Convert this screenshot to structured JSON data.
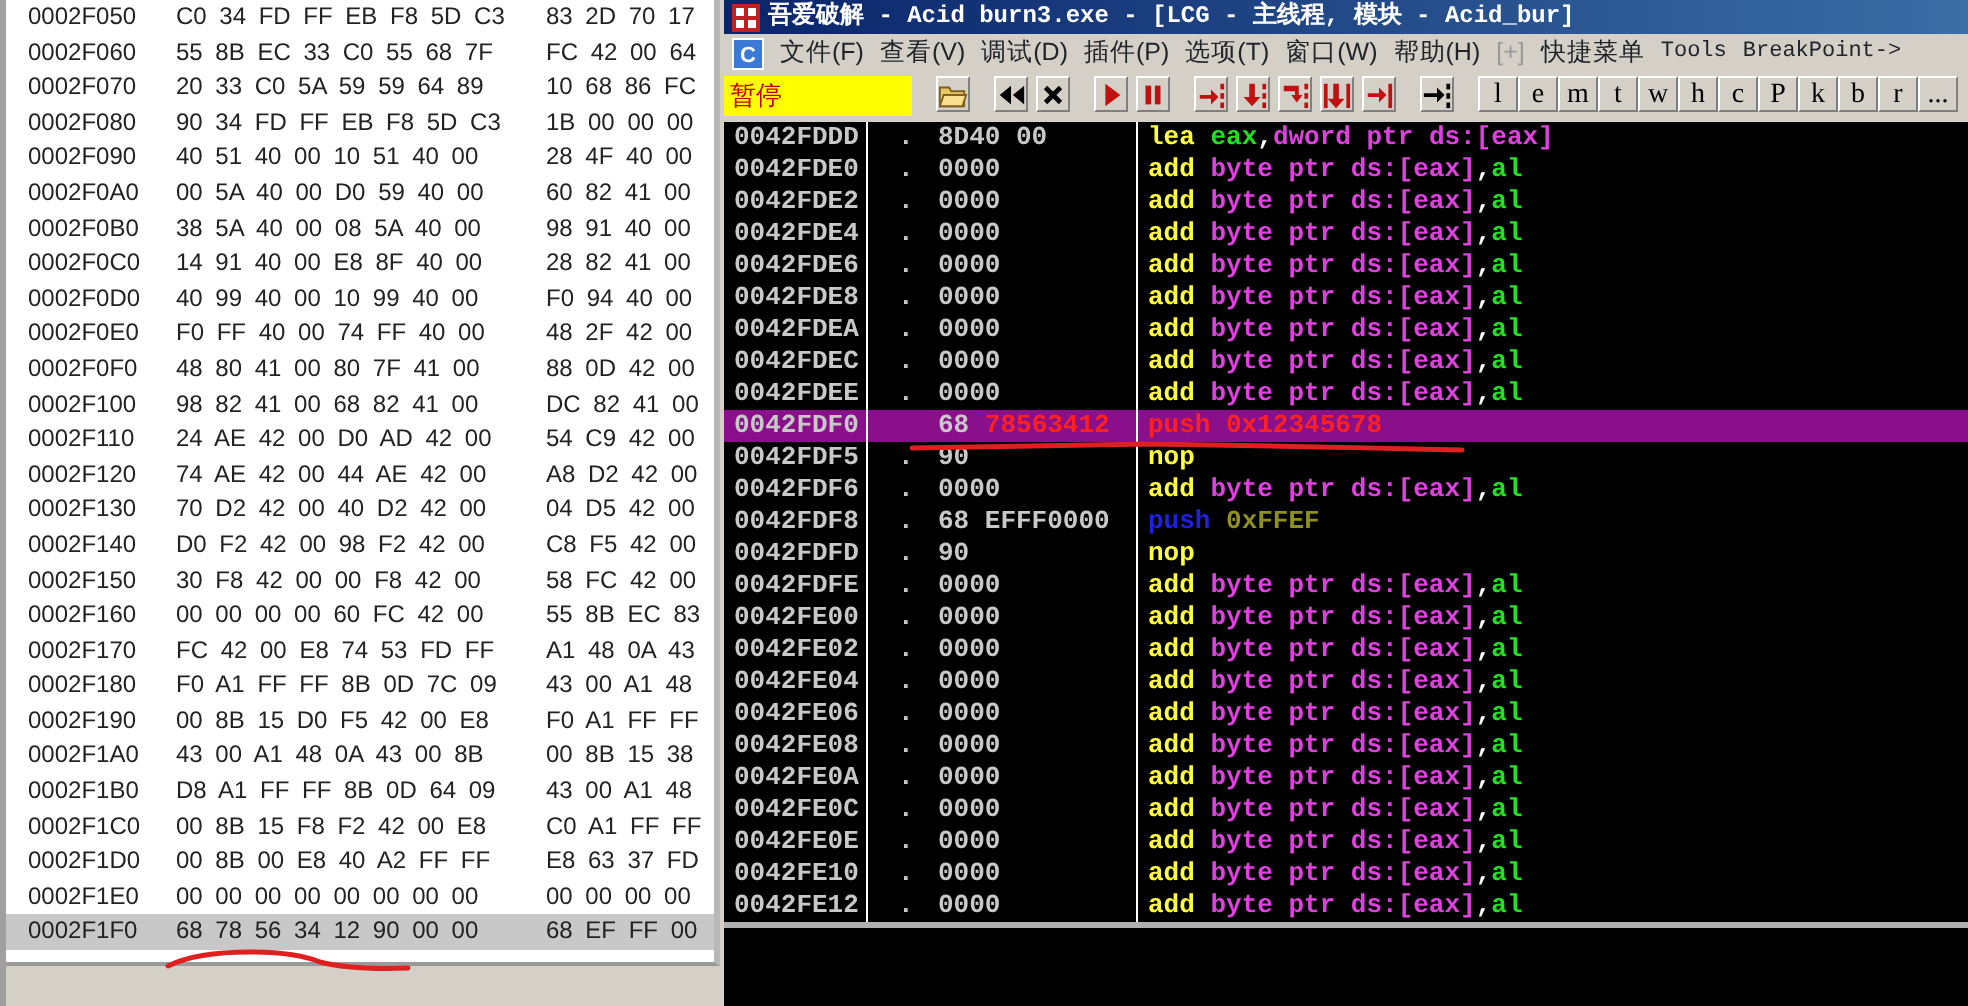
{
  "hex_dump": {
    "rows": [
      {
        "address": "0002F050",
        "group_1": "C0 34 FD FF EB F8 5D C3",
        "group_2": "83 2D 70 17",
        "selected": false
      },
      {
        "address": "0002F060",
        "group_1": "55 8B EC 33 C0 55 68 7F",
        "group_2": "FC 42 00 64",
        "selected": false
      },
      {
        "address": "0002F070",
        "group_1": "20 33 C0 5A 59 59 64 89",
        "group_2": "10 68 86 FC",
        "selected": false
      },
      {
        "address": "0002F080",
        "group_1": "90 34 FD FF EB F8 5D C3",
        "group_2": "1B 00 00 00",
        "selected": false
      },
      {
        "address": "0002F090",
        "group_1": "40 51 40 00 10 51 40 00",
        "group_2": "28 4F 40 00",
        "selected": false
      },
      {
        "address": "0002F0A0",
        "group_1": "00 5A 40 00 D0 59 40 00",
        "group_2": "60 82 41 00",
        "selected": false
      },
      {
        "address": "0002F0B0",
        "group_1": "38 5A 40 00 08 5A 40 00",
        "group_2": "98 91 40 00",
        "selected": false
      },
      {
        "address": "0002F0C0",
        "group_1": "14 91 40 00 E8 8F 40 00",
        "group_2": "28 82 41 00",
        "selected": false
      },
      {
        "address": "0002F0D0",
        "group_1": "40 99 40 00 10 99 40 00",
        "group_2": "F0 94 40 00",
        "selected": false
      },
      {
        "address": "0002F0E0",
        "group_1": "F0 FF 40 00 74 FF 40 00",
        "group_2": "48 2F 42 00",
        "selected": false
      },
      {
        "address": "0002F0F0",
        "group_1": "48 80 41 00 80 7F 41 00",
        "group_2": "88 0D 42 00",
        "selected": false
      },
      {
        "address": "0002F100",
        "group_1": "98 82 41 00 68 82 41 00",
        "group_2": "DC 82 41 00",
        "selected": false
      },
      {
        "address": "0002F110",
        "group_1": "24 AE 42 00 D0 AD 42 00",
        "group_2": "54 C9 42 00",
        "selected": false
      },
      {
        "address": "0002F120",
        "group_1": "74 AE 42 00 44 AE 42 00",
        "group_2": "A8 D2 42 00",
        "selected": false
      },
      {
        "address": "0002F130",
        "group_1": "70 D2 42 00 40 D2 42 00",
        "group_2": "04 D5 42 00",
        "selected": false
      },
      {
        "address": "0002F140",
        "group_1": "D0 F2 42 00 98 F2 42 00",
        "group_2": "C8 F5 42 00",
        "selected": false
      },
      {
        "address": "0002F150",
        "group_1": "30 F8 42 00 00 F8 42 00",
        "group_2": "58 FC 42 00",
        "selected": false
      },
      {
        "address": "0002F160",
        "group_1": "00 00 00 00 60 FC 42 00",
        "group_2": "55 8B EC 83",
        "selected": false
      },
      {
        "address": "0002F170",
        "group_1": "FC 42 00 E8 74 53 FD FF",
        "group_2": "A1 48 0A 43",
        "selected": false
      },
      {
        "address": "0002F180",
        "group_1": "F0 A1 FF FF 8B 0D 7C 09",
        "group_2": "43 00 A1 48",
        "selected": false
      },
      {
        "address": "0002F190",
        "group_1": "00 8B 15 D0 F5 42 00 E8",
        "group_2": "F0 A1 FF FF",
        "selected": false
      },
      {
        "address": "0002F1A0",
        "group_1": "43 00 A1 48 0A 43 00 8B",
        "group_2": "00 8B 15 38",
        "selected": false
      },
      {
        "address": "0002F1B0",
        "group_1": "D8 A1 FF FF 8B 0D 64 09",
        "group_2": "43 00 A1 48",
        "selected": false
      },
      {
        "address": "0002F1C0",
        "group_1": "00 8B 15 F8 F2 42 00 E8",
        "group_2": "C0 A1 FF FF",
        "selected": false
      },
      {
        "address": "0002F1D0",
        "group_1": "00 8B 00 E8 40 A2 FF FF",
        "group_2": "E8 63 37 FD",
        "selected": false
      },
      {
        "address": "0002F1E0",
        "group_1": "00 00 00 00 00 00 00 00",
        "group_2": "00 00 00 00",
        "selected": false
      },
      {
        "address": "0002F1F0",
        "group_1": "68 78 56 34 12 90 00 00",
        "group_2": "68 EF FF 00",
        "selected": true
      }
    ]
  },
  "window": {
    "title": "吾爱破解 - Acid burn3.exe - [LCG -  主线程, 模块 - Acid_bur]"
  },
  "menu_button": "C",
  "menu": [
    {
      "label": "文件(F)",
      "disabled": false
    },
    {
      "label": "查看(V)",
      "disabled": false
    },
    {
      "label": "调试(D)",
      "disabled": false
    },
    {
      "label": "插件(P)",
      "disabled": false
    },
    {
      "label": "选项(T)",
      "disabled": false
    },
    {
      "label": "窗口(W)",
      "disabled": false
    },
    {
      "label": "帮助(H)",
      "disabled": false
    },
    {
      "label": "[+]",
      "disabled": true
    },
    {
      "label": "快捷菜单",
      "disabled": false
    },
    {
      "label": "Tools",
      "disabled": false
    },
    {
      "label": "BreakPoint->",
      "disabled": false
    }
  ],
  "toolbar": {
    "status": "暂停",
    "icon_buttons": [
      {
        "kind": "open"
      },
      {
        "kind": "rewind"
      },
      {
        "kind": "close"
      },
      {
        "kind": "run"
      },
      {
        "kind": "pause"
      },
      {
        "kind": "step_into"
      },
      {
        "kind": "step_over"
      },
      {
        "kind": "trace_into"
      },
      {
        "kind": "trace_over"
      },
      {
        "kind": "till_return"
      },
      {
        "kind": "goto"
      }
    ],
    "letter_buttons": [
      "l",
      "e",
      "m",
      "t",
      "w",
      "h",
      "c",
      "P",
      "k",
      "b",
      "r",
      "..."
    ]
  },
  "disassembly": {
    "rows": [
      {
        "address": "0042FDDD",
        "marker": ".",
        "bytes": [
          {
            "text": "8D40 00",
            "kind": "plain"
          }
        ],
        "instruction": [
          {
            "text": "lea",
            "kind": "op"
          },
          {
            "text": "eax",
            "kind": "reg"
          },
          {
            "text": ",",
            "kind": "sep"
          },
          {
            "text": "dword ptr ds:[eax]",
            "kind": "mem"
          }
        ],
        "selected": false
      },
      {
        "address": "0042FDE0",
        "marker": ".",
        "bytes": [
          {
            "text": "0000",
            "kind": "plain"
          }
        ],
        "instruction": [
          {
            "text": "add",
            "kind": "op"
          },
          {
            "text": "byte ptr ds:[eax]",
            "kind": "mem"
          },
          {
            "text": ",",
            "kind": "sep"
          },
          {
            "text": "al",
            "kind": "reg"
          }
        ],
        "selected": false
      },
      {
        "address": "0042FDE2",
        "marker": ".",
        "bytes": [
          {
            "text": "0000",
            "kind": "plain"
          }
        ],
        "instruction": [
          {
            "text": "add",
            "kind": "op"
          },
          {
            "text": "byte ptr ds:[eax]",
            "kind": "mem"
          },
          {
            "text": ",",
            "kind": "sep"
          },
          {
            "text": "al",
            "kind": "reg"
          }
        ],
        "selected": false
      },
      {
        "address": "0042FDE4",
        "marker": ".",
        "bytes": [
          {
            "text": "0000",
            "kind": "plain"
          }
        ],
        "instruction": [
          {
            "text": "add",
            "kind": "op"
          },
          {
            "text": "byte ptr ds:[eax]",
            "kind": "mem"
          },
          {
            "text": ",",
            "kind": "sep"
          },
          {
            "text": "al",
            "kind": "reg"
          }
        ],
        "selected": false
      },
      {
        "address": "0042FDE6",
        "marker": ".",
        "bytes": [
          {
            "text": "0000",
            "kind": "plain"
          }
        ],
        "instruction": [
          {
            "text": "add",
            "kind": "op"
          },
          {
            "text": "byte ptr ds:[eax]",
            "kind": "mem"
          },
          {
            "text": ",",
            "kind": "sep"
          },
          {
            "text": "al",
            "kind": "reg"
          }
        ],
        "selected": false
      },
      {
        "address": "0042FDE8",
        "marker": ".",
        "bytes": [
          {
            "text": "0000",
            "kind": "plain"
          }
        ],
        "instruction": [
          {
            "text": "add",
            "kind": "op"
          },
          {
            "text": "byte ptr ds:[eax]",
            "kind": "mem"
          },
          {
            "text": ",",
            "kind": "sep"
          },
          {
            "text": "al",
            "kind": "reg"
          }
        ],
        "selected": false
      },
      {
        "address": "0042FDEA",
        "marker": ".",
        "bytes": [
          {
            "text": "0000",
            "kind": "plain"
          }
        ],
        "instruction": [
          {
            "text": "add",
            "kind": "op"
          },
          {
            "text": "byte ptr ds:[eax]",
            "kind": "mem"
          },
          {
            "text": ",",
            "kind": "sep"
          },
          {
            "text": "al",
            "kind": "reg"
          }
        ],
        "selected": false
      },
      {
        "address": "0042FDEC",
        "marker": ".",
        "bytes": [
          {
            "text": "0000",
            "kind": "plain"
          }
        ],
        "instruction": [
          {
            "text": "add",
            "kind": "op"
          },
          {
            "text": "byte ptr ds:[eax]",
            "kind": "mem"
          },
          {
            "text": ",",
            "kind": "sep"
          },
          {
            "text": "al",
            "kind": "reg"
          }
        ],
        "selected": false
      },
      {
        "address": "0042FDEE",
        "marker": ".",
        "bytes": [
          {
            "text": "0000",
            "kind": "plain"
          }
        ],
        "instruction": [
          {
            "text": "add",
            "kind": "op"
          },
          {
            "text": "byte ptr ds:[eax]",
            "kind": "mem"
          },
          {
            "text": ",",
            "kind": "sep"
          },
          {
            "text": "al",
            "kind": "reg"
          }
        ],
        "selected": false
      },
      {
        "address": "0042FDF0",
        "bytes": [
          {
            "text": "68",
            "kind": "plain"
          },
          {
            "text": "78563412",
            "kind": "changed"
          }
        ],
        "instruction": [
          {
            "text": "push 0x12345678",
            "kind": "changed"
          }
        ],
        "selected": true
      },
      {
        "address": "0042FDF5",
        "marker": ".",
        "bytes": [
          {
            "text": "90",
            "kind": "plain"
          }
        ],
        "instruction": [
          {
            "text": "nop",
            "kind": "op"
          }
        ],
        "selected": false
      },
      {
        "address": "0042FDF6",
        "marker": ".",
        "bytes": [
          {
            "text": "0000",
            "kind": "plain"
          }
        ],
        "instruction": [
          {
            "text": "add",
            "kind": "op"
          },
          {
            "text": "byte ptr ds:[eax]",
            "kind": "mem"
          },
          {
            "text": ",",
            "kind": "sep"
          },
          {
            "text": "al",
            "kind": "reg"
          }
        ],
        "selected": false
      },
      {
        "address": "0042FDF8",
        "marker": ".",
        "bytes": [
          {
            "text": "68 EFFF0000",
            "kind": "plain"
          }
        ],
        "instruction": [
          {
            "text": "push",
            "kind": "stack"
          },
          {
            "text": "0xFFEF",
            "kind": "imm"
          }
        ],
        "selected": false
      },
      {
        "address": "0042FDFD",
        "marker": ".",
        "bytes": [
          {
            "text": "90",
            "kind": "plain"
          }
        ],
        "instruction": [
          {
            "text": "nop",
            "kind": "op"
          }
        ],
        "selected": false
      },
      {
        "address": "0042FDFE",
        "marker": ".",
        "bytes": [
          {
            "text": "0000",
            "kind": "plain"
          }
        ],
        "instruction": [
          {
            "text": "add",
            "kind": "op"
          },
          {
            "text": "byte ptr ds:[eax]",
            "kind": "mem"
          },
          {
            "text": ",",
            "kind": "sep"
          },
          {
            "text": "al",
            "kind": "reg"
          }
        ],
        "selected": false
      },
      {
        "address": "0042FE00",
        "marker": ".",
        "bytes": [
          {
            "text": "0000",
            "kind": "plain"
          }
        ],
        "instruction": [
          {
            "text": "add",
            "kind": "op"
          },
          {
            "text": "byte ptr ds:[eax]",
            "kind": "mem"
          },
          {
            "text": ",",
            "kind": "sep"
          },
          {
            "text": "al",
            "kind": "reg"
          }
        ],
        "selected": false
      },
      {
        "address": "0042FE02",
        "marker": ".",
        "bytes": [
          {
            "text": "0000",
            "kind": "plain"
          }
        ],
        "instruction": [
          {
            "text": "add",
            "kind": "op"
          },
          {
            "text": "byte ptr ds:[eax]",
            "kind": "mem"
          },
          {
            "text": ",",
            "kind": "sep"
          },
          {
            "text": "al",
            "kind": "reg"
          }
        ],
        "selected": false
      },
      {
        "address": "0042FE04",
        "marker": ".",
        "bytes": [
          {
            "text": "0000",
            "kind": "plain"
          }
        ],
        "instruction": [
          {
            "text": "add",
            "kind": "op"
          },
          {
            "text": "byte ptr ds:[eax]",
            "kind": "mem"
          },
          {
            "text": ",",
            "kind": "sep"
          },
          {
            "text": "al",
            "kind": "reg"
          }
        ],
        "selected": false
      },
      {
        "address": "0042FE06",
        "marker": ".",
        "bytes": [
          {
            "text": "0000",
            "kind": "plain"
          }
        ],
        "instruction": [
          {
            "text": "add",
            "kind": "op"
          },
          {
            "text": "byte ptr ds:[eax]",
            "kind": "mem"
          },
          {
            "text": ",",
            "kind": "sep"
          },
          {
            "text": "al",
            "kind": "reg"
          }
        ],
        "selected": false
      },
      {
        "address": "0042FE08",
        "marker": ".",
        "bytes": [
          {
            "text": "0000",
            "kind": "plain"
          }
        ],
        "instruction": [
          {
            "text": "add",
            "kind": "op"
          },
          {
            "text": "byte ptr ds:[eax]",
            "kind": "mem"
          },
          {
            "text": ",",
            "kind": "sep"
          },
          {
            "text": "al",
            "kind": "reg"
          }
        ],
        "selected": false
      },
      {
        "address": "0042FE0A",
        "marker": ".",
        "bytes": [
          {
            "text": "0000",
            "kind": "plain"
          }
        ],
        "instruction": [
          {
            "text": "add",
            "kind": "op"
          },
          {
            "text": "byte ptr ds:[eax]",
            "kind": "mem"
          },
          {
            "text": ",",
            "kind": "sep"
          },
          {
            "text": "al",
            "kind": "reg"
          }
        ],
        "selected": false
      },
      {
        "address": "0042FE0C",
        "marker": ".",
        "bytes": [
          {
            "text": "0000",
            "kind": "plain"
          }
        ],
        "instruction": [
          {
            "text": "add",
            "kind": "op"
          },
          {
            "text": "byte ptr ds:[eax]",
            "kind": "mem"
          },
          {
            "text": ",",
            "kind": "sep"
          },
          {
            "text": "al",
            "kind": "reg"
          }
        ],
        "selected": false
      },
      {
        "address": "0042FE0E",
        "marker": ".",
        "bytes": [
          {
            "text": "0000",
            "kind": "plain"
          }
        ],
        "instruction": [
          {
            "text": "add",
            "kind": "op"
          },
          {
            "text": "byte ptr ds:[eax]",
            "kind": "mem"
          },
          {
            "text": ",",
            "kind": "sep"
          },
          {
            "text": "al",
            "kind": "reg"
          }
        ],
        "selected": false
      },
      {
        "address": "0042FE10",
        "marker": ".",
        "bytes": [
          {
            "text": "0000",
            "kind": "plain"
          }
        ],
        "instruction": [
          {
            "text": "add",
            "kind": "op"
          },
          {
            "text": "byte ptr ds:[eax]",
            "kind": "mem"
          },
          {
            "text": ",",
            "kind": "sep"
          },
          {
            "text": "al",
            "kind": "reg"
          }
        ],
        "selected": false
      },
      {
        "address": "0042FE12",
        "marker": ".",
        "bytes": [
          {
            "text": "0000",
            "kind": "plain"
          }
        ],
        "instruction": [
          {
            "text": "add",
            "kind": "op"
          },
          {
            "text": "byte ptr ds:[eax]",
            "kind": "mem"
          },
          {
            "text": ",",
            "kind": "sep"
          },
          {
            "text": "al",
            "kind": "reg"
          }
        ],
        "selected": false
      }
    ]
  }
}
